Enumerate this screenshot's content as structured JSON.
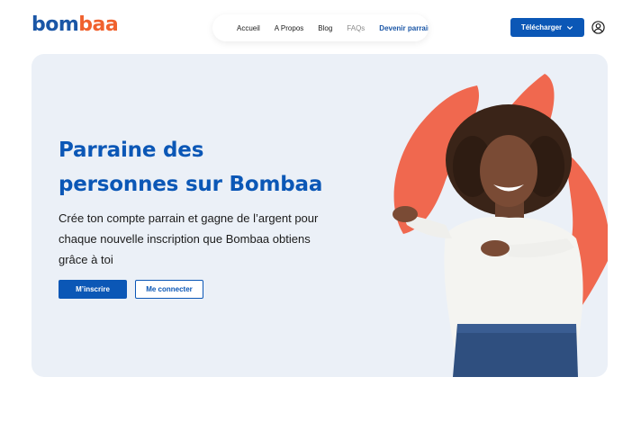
{
  "brand": {
    "part1": "bom",
    "part2": "baa",
    "primary": "#1a56a6",
    "accent": "#f0612e"
  },
  "nav": {
    "links": [
      {
        "label": "Accueil"
      },
      {
        "label": "A Propos"
      },
      {
        "label": "Blog"
      },
      {
        "label": "FAQs"
      },
      {
        "label": "Devenir parrain"
      }
    ]
  },
  "header": {
    "download_label": "Télécharger",
    "download_icon": "chevron-down-icon",
    "account_icon": "user-icon"
  },
  "hero": {
    "title_line1": "Parraine des",
    "title_line2": "personnes sur Bombaa",
    "description": "Crée ton compte parrain et gagne de l’argent pour chaque nouvelle inscription que Bombaa obtiens grâce à toi",
    "signup_label": "M’inscrire",
    "login_label": "Me connecter",
    "background": "#ebf0f7",
    "brush_color": "#f0684f"
  }
}
